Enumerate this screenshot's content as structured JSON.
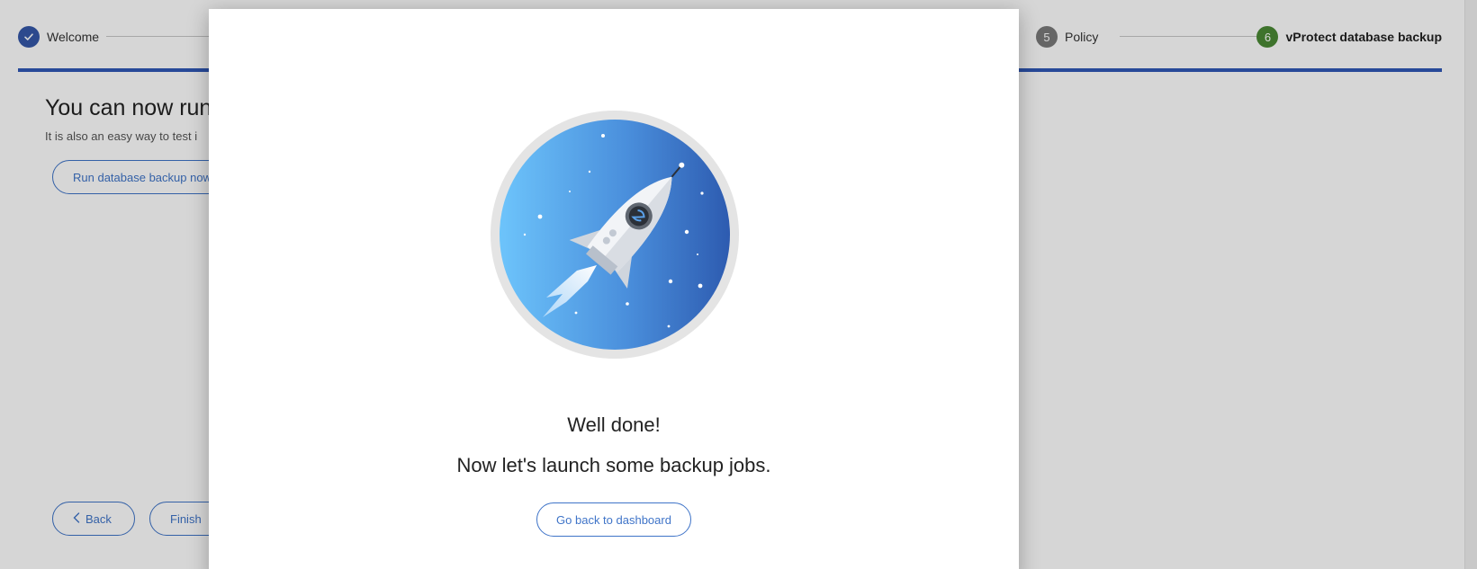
{
  "stepper": {
    "steps": [
      {
        "number": "",
        "label": "Welcome",
        "state": "completed",
        "color": "#3558a8"
      },
      {
        "number": "5",
        "label": "Policy",
        "state": "pending",
        "color": "#7a7a7a"
      },
      {
        "number": "6",
        "label": "vProtect database backup",
        "state": "active",
        "color": "#4b8a35"
      }
    ],
    "accent_color": "#2f57b5"
  },
  "background": {
    "heading": "You can now run",
    "subtext": "It is also an easy way to test i",
    "run_button": "Run database backup now",
    "back_button": "Back",
    "finish_button": "Finish"
  },
  "modal": {
    "illustration": "rocket-illustration",
    "title": "Well done!",
    "subtitle": "Now let's launch some backup jobs.",
    "dashboard_button": "Go back to dashboard"
  },
  "icons": {
    "check": "check-icon",
    "chevron_left": "chevron-left-icon",
    "rocket": "rocket-icon"
  }
}
